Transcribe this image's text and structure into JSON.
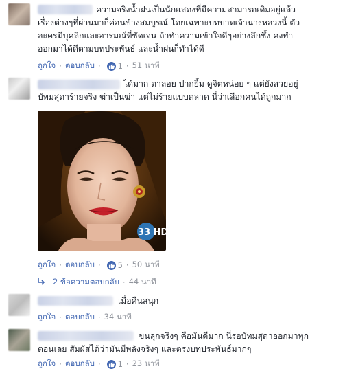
{
  "comments": [
    {
      "lines": [
        "ความจริงน้ำฝนเป็นนักแสดงที่มีความสามารถเดิมอยู่แล้ว",
        "เรื่องต่างๆที่ผ่านมาก็ค่อนข้างสมบูรณ์ โดยเฉพาะบทบาทเจ้านางหลวงนี้ ตัว",
        "ละครมีบุคลิกและอารมณ์ที่ชัดเจน ถ้าทำความเข้าใจดีๆอย่างลึกซึ้ง คงทำ",
        "ออกมาได้ดีตามบทประพันธ์ และน้ำฝนก็ทำได้ดี"
      ],
      "like": "ถูกใจ",
      "reply": "ตอบกลับ",
      "likes": "1",
      "time": "51 นาที"
    },
    {
      "lines": [
        "ได้มาก ตาลอย ปากยิ้ม ดูจิตหน่อย ๆ แต่ยังสวยอยู่",
        "บัทมสุดาร้ายจริง ฆ่าเป็นฆ่า แต่ไม่ร้ายแบบตลาด นี่ว่าเลือกคนได้ถูกมาก"
      ],
      "like": "ถูกใจ",
      "reply": "ตอบกลับ",
      "likes": "5",
      "time": "50 นาที",
      "photo_logo": "33 HD",
      "replies_label": "2 ข้อความตอบกลับ",
      "replies_time": "44 นาที"
    },
    {
      "lines": [
        "เมื่อคืนสนุก"
      ],
      "like": "ถูกใจ",
      "reply": "ตอบกลับ",
      "time": "34 นาที"
    },
    {
      "lines": [
        "ขนลุกจริงๆ คือมันดีมาก นี่รอบัทมสุดาออกมาทุก",
        "ตอนเลย สัมผัสได้ว่ามันมีพลังจริงๆ และตรงบทประพันธ์มากๆ"
      ],
      "like": "ถูกใจ",
      "reply": "ตอบกลับ",
      "likes": "1",
      "time": "23 นาที"
    }
  ],
  "colors": {
    "link": "#4267b2",
    "meta": "#90949c",
    "text": "#1d2129"
  }
}
